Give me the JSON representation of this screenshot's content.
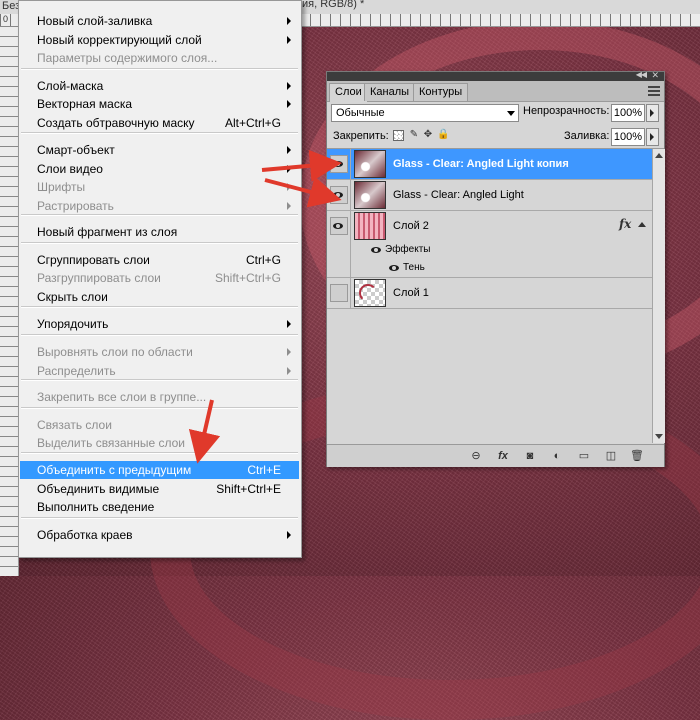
{
  "titlebar": {
    "left_text": "Без",
    "right_text": "ия, RGB/8) *"
  },
  "ruler": {
    "zero": "0"
  },
  "colors": {
    "highlight": "#3399ff",
    "selected_layer": "#3e97ff",
    "arrow_red": "#e0392b"
  },
  "menu": {
    "items": [
      {
        "label": "Новый слой-заливка",
        "shortcut": "",
        "submenu": true,
        "disabled": false
      },
      {
        "label": "Новый корректирующий слой",
        "shortcut": "",
        "submenu": true,
        "disabled": false
      },
      {
        "label": "Параметры содержимого слоя...",
        "shortcut": "",
        "submenu": false,
        "disabled": true
      },
      {
        "label": "Слой-маска",
        "shortcut": "",
        "submenu": true,
        "disabled": false
      },
      {
        "label": "Векторная маска",
        "shortcut": "",
        "submenu": true,
        "disabled": false
      },
      {
        "label": "Создать обтравочную маску",
        "shortcut": "Alt+Ctrl+G",
        "submenu": false,
        "disabled": false
      },
      {
        "label": "Смарт-объект",
        "shortcut": "",
        "submenu": true,
        "disabled": false
      },
      {
        "label": "Слои видео",
        "shortcut": "",
        "submenu": true,
        "disabled": false
      },
      {
        "label": "Шрифты",
        "shortcut": "",
        "submenu": true,
        "disabled": true
      },
      {
        "label": "Растрировать",
        "shortcut": "",
        "submenu": true,
        "disabled": true
      },
      {
        "label": "Новый фрагмент из слоя",
        "shortcut": "",
        "submenu": false,
        "disabled": false
      },
      {
        "label": "Сгруппировать слои",
        "shortcut": "Ctrl+G",
        "submenu": false,
        "disabled": false
      },
      {
        "label": "Разгруппировать слои",
        "shortcut": "Shift+Ctrl+G",
        "submenu": false,
        "disabled": true
      },
      {
        "label": "Скрыть слои",
        "shortcut": "",
        "submenu": false,
        "disabled": false
      },
      {
        "label": "Упорядочить",
        "shortcut": "",
        "submenu": true,
        "disabled": false
      },
      {
        "label": "Выровнять слои по области",
        "shortcut": "",
        "submenu": true,
        "disabled": true
      },
      {
        "label": "Распределить",
        "shortcut": "",
        "submenu": true,
        "disabled": true
      },
      {
        "label": "Закрепить все слои в группе...",
        "shortcut": "",
        "submenu": false,
        "disabled": true
      },
      {
        "label": "Связать слои",
        "shortcut": "",
        "submenu": false,
        "disabled": true
      },
      {
        "label": "Выделить связанные слои",
        "shortcut": "",
        "submenu": false,
        "disabled": true
      },
      {
        "label": "Объединить с предыдущим",
        "shortcut": "Ctrl+E",
        "submenu": false,
        "disabled": false,
        "highlighted": true
      },
      {
        "label": "Объединить видимые",
        "shortcut": "Shift+Ctrl+E",
        "submenu": false,
        "disabled": false
      },
      {
        "label": "Выполнить сведение",
        "shortcut": "",
        "submenu": false,
        "disabled": false
      },
      {
        "label": "Обработка краев",
        "shortcut": "",
        "submenu": true,
        "disabled": false
      }
    ]
  },
  "panel": {
    "tabs": [
      "Слои",
      "Каналы",
      "Контуры"
    ],
    "blend_mode": "Обычные",
    "opacity_label": "Непрозрачность:",
    "opacity_value": "100%",
    "lock_label": "Закрепить:",
    "fill_label": "Заливка:",
    "fill_value": "100%",
    "layers": [
      {
        "name": "Glass - Clear: Angled Light копия",
        "selected": true,
        "visible": true,
        "thumb": "glass"
      },
      {
        "name": "Glass - Clear: Angled Light",
        "selected": false,
        "visible": true,
        "thumb": "glass"
      },
      {
        "name": "Слой 2",
        "selected": false,
        "visible": true,
        "thumb": "stripes",
        "fx": "fx",
        "effects_label": "Эффекты",
        "effect": "Тень"
      },
      {
        "name": "Слой 1",
        "selected": false,
        "visible": false,
        "thumb": "checker"
      }
    ],
    "bottom_icons": [
      "link-icon",
      "fx-icon",
      "mask-icon",
      "adjustment-icon",
      "folder-icon",
      "new-layer-icon",
      "trash-icon"
    ],
    "bottom_glyphs": [
      "⊖",
      "fx",
      "◙",
      "◐",
      "▭",
      "◫",
      "🗑"
    ]
  }
}
